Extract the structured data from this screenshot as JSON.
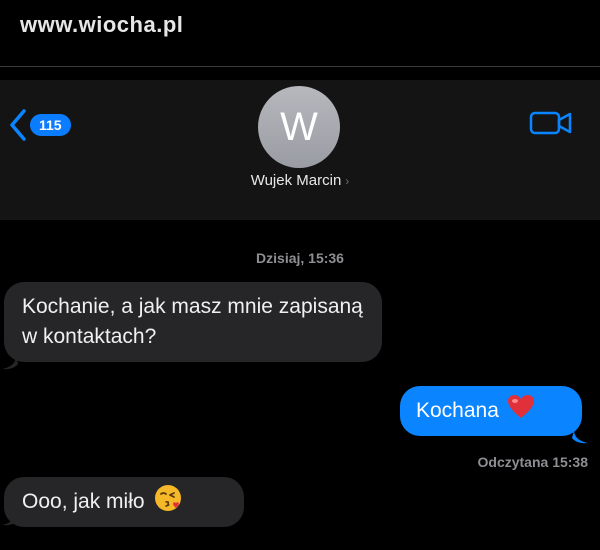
{
  "watermark": "www.wiocha.pl",
  "header": {
    "back_count": "115",
    "avatar_initial": "W",
    "contact_name": "Wujek Marcin",
    "chevron": "›"
  },
  "conversation": {
    "timestamp": "Dzisiaj, 15:36",
    "messages": [
      {
        "direction": "incoming",
        "text": "Kochanie, a jak masz mnie zapisaną w kontaktach?"
      },
      {
        "direction": "outgoing",
        "text": "Kochana",
        "emoji": "heart-icon"
      },
      {
        "direction": "incoming",
        "text": "Ooo, jak miło",
        "emoji": "kissing-face-icon"
      }
    ],
    "read_receipt": "Odczytana 15:38"
  },
  "colors": {
    "accent": "#0a84ff",
    "incoming_bubble": "#262628",
    "background": "#000000"
  }
}
